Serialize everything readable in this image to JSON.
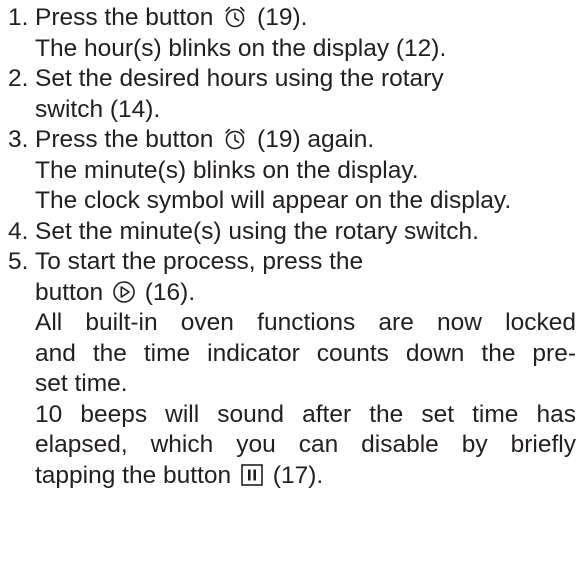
{
  "steps": [
    {
      "number": "1.",
      "lines": [
        {
          "before": "Press the button",
          "after": "(19)."
        },
        {
          "text": "The hour(s) blinks on the display (12)."
        }
      ]
    },
    {
      "number": "2.",
      "lines": [
        {
          "text": "Set the desired hours using the rotary"
        },
        {
          "text": "switch (14)."
        }
      ]
    },
    {
      "number": "3.",
      "lines": [
        {
          "before": "Press the button",
          "after": "(19) again."
        },
        {
          "text": "The minute(s) blinks on the display."
        },
        {
          "text": "The clock symbol will appear on the display."
        }
      ]
    },
    {
      "number": "4.",
      "lines": [
        {
          "text": "Set the minute(s) using the rotary switch."
        }
      ]
    },
    {
      "number": "5.",
      "lines": [
        {
          "text": "To start the process, press the"
        },
        {
          "before": "button",
          "after": "(16)."
        },
        {
          "text": "All built-in oven functions are now locked"
        },
        {
          "text": "and the time indicator counts down the pre-"
        },
        {
          "text": "set time."
        },
        {
          "text": "10 beeps will sound after the set time has"
        },
        {
          "text": "elapsed, which you can disable by briefly"
        },
        {
          "before": "tapping the button",
          "after": "(17)."
        }
      ]
    }
  ],
  "icons": {
    "timer": "alarm-clock-icon",
    "start": "play-circle-icon",
    "pause": "pause-square-icon"
  }
}
